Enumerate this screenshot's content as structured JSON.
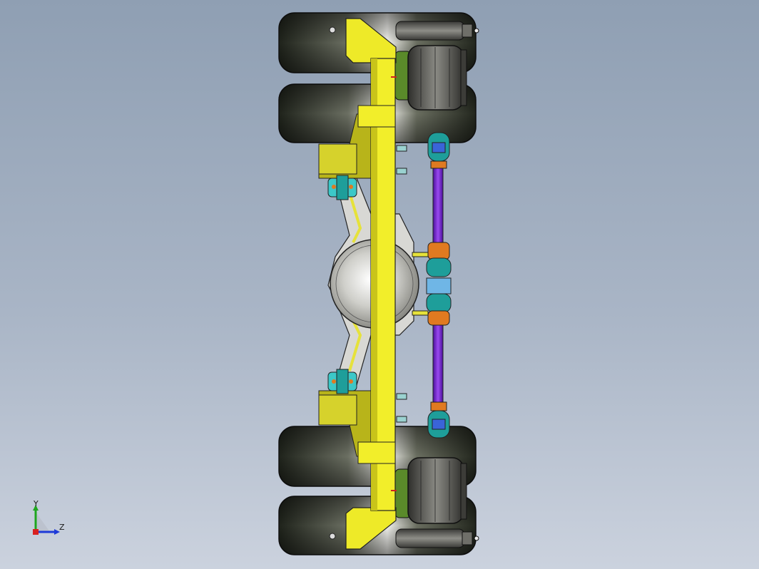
{
  "view": {
    "background_top": "#8f9fb3",
    "background_bottom": "#cbd2de"
  },
  "colors": {
    "frame": "#f2ee2a",
    "frame_shadow": "#c9c41a",
    "bracket": "#e0dc2a",
    "tire": "#2b2f26",
    "axle_housing": "#d8d8d4",
    "air_spring": "#4a4a46",
    "air_spring_seat": "#5a8a2a",
    "tie_rod": "#7a22d6",
    "tie_rod_joint": "#1e9e9a",
    "clamp_cyan": "#3cc8c8",
    "clamp_orange": "#e07a20"
  },
  "icons": {
    "triad": "coordinate-triad-icon"
  },
  "triad": {
    "y_label": "Y",
    "z_label": "Z"
  }
}
